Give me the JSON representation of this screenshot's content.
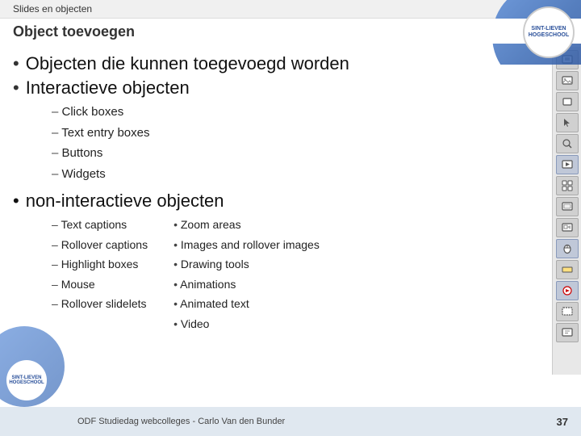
{
  "topbar": {
    "label": "Slides en objecten"
  },
  "header": {
    "title": "Object toevoegen"
  },
  "logo": {
    "text": "SINT-LIEVEN\nHOGESCHOOL"
  },
  "bullets": {
    "b1": "Objecten die kunnen toegevoegd worden",
    "b2": "Interactieve objecten",
    "b3": "non-interactieve objecten"
  },
  "interactive_items": [
    "Click boxes",
    "Text entry boxes",
    "Buttons",
    "Widgets"
  ],
  "non_interactive_left": [
    "Text captions",
    "Rollover captions",
    "Highlight boxes",
    "Mouse",
    "Rollover slidelets"
  ],
  "non_interactive_right": [
    "Zoom areas",
    "Images and rollover images",
    "Drawing tools",
    "Animations",
    "Animated text",
    "Video"
  ],
  "footer": {
    "label": "ODF Studiedag webcolleges - Carlo Van den Bunder",
    "page": "37"
  },
  "toolbar_icons": [
    {
      "name": "text-box-icon",
      "symbol": "▭"
    },
    {
      "name": "image-icon",
      "symbol": "🖼"
    },
    {
      "name": "rectangle-icon",
      "symbol": "□"
    },
    {
      "name": "cursor-icon",
      "symbol": "↖"
    },
    {
      "name": "search-icon",
      "symbol": "🔍"
    },
    {
      "name": "media-icon",
      "symbol": "▶"
    },
    {
      "name": "widget-icon",
      "symbol": "⊞"
    },
    {
      "name": "rollover-icon",
      "symbol": "⬡"
    },
    {
      "name": "zoom-icon",
      "symbol": "⊕"
    },
    {
      "name": "mouse-icon",
      "symbol": "⊙"
    },
    {
      "name": "highlight-icon",
      "symbol": "▬"
    },
    {
      "name": "animation-icon",
      "symbol": "✦"
    },
    {
      "name": "click-icon",
      "symbol": "☰"
    },
    {
      "name": "extra-icon",
      "symbol": "⊟"
    }
  ],
  "colors": {
    "accent": "#3a6ab5",
    "bg_toolbar": "#e8e8e8",
    "bg_footer": "#e0e8f0"
  }
}
